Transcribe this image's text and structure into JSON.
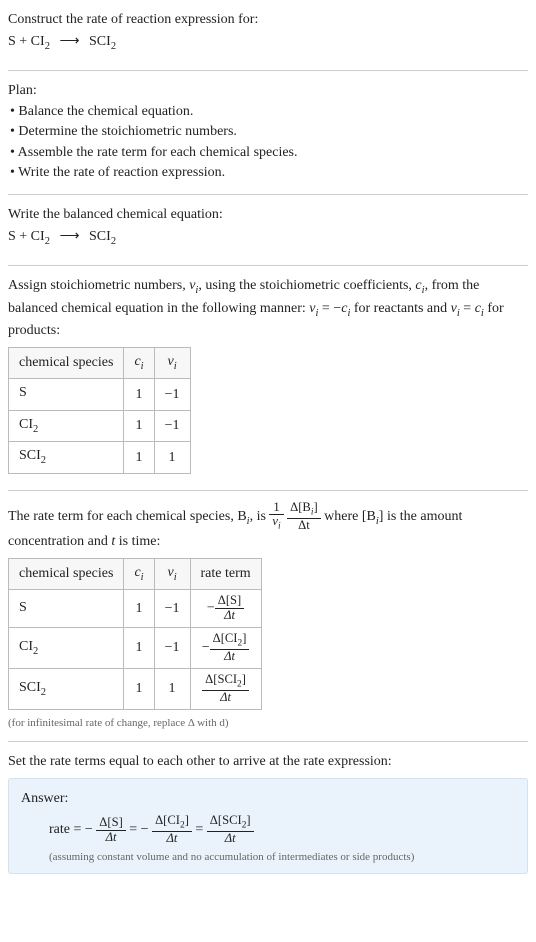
{
  "header": {
    "prompt": "Construct the rate of reaction expression for:",
    "reaction_lhs": "S + CI",
    "reaction_lhs_sub": "2",
    "arrow": "⟶",
    "reaction_rhs": "SCI",
    "reaction_rhs_sub": "2"
  },
  "plan": {
    "title": "Plan:",
    "items": [
      "• Balance the chemical equation.",
      "• Determine the stoichiometric numbers.",
      "• Assemble the rate term for each chemical species.",
      "• Write the rate of reaction expression."
    ]
  },
  "balanced": {
    "intro": "Write the balanced chemical equation:",
    "lhs": "S + CI",
    "lhs_sub": "2",
    "arrow": "⟶",
    "rhs": "SCI",
    "rhs_sub": "2"
  },
  "stoich_text": {
    "p1a": "Assign stoichiometric numbers, ",
    "nu": "ν",
    "isub": "i",
    "p1b": ", using the stoichiometric coefficients, ",
    "c": "c",
    "p1c": ", from the balanced chemical equation in the following manner: ",
    "eq1": " = −",
    "p1d": " for reactants and ",
    "eq2": " = ",
    "p1e": " for products:"
  },
  "table1": {
    "headers": {
      "species": "chemical species",
      "ci": "c",
      "ci_sub": "i",
      "vi": "ν",
      "vi_sub": "i"
    },
    "rows": [
      {
        "species": "S",
        "sub": "",
        "ci": "1",
        "vi": "−1"
      },
      {
        "species": "CI",
        "sub": "2",
        "ci": "1",
        "vi": "−1"
      },
      {
        "species": "SCI",
        "sub": "2",
        "ci": "1",
        "vi": "1"
      }
    ]
  },
  "rateterm_text": {
    "a": "The rate term for each chemical species, B",
    "isub": "i",
    "b": ", is ",
    "one": "1",
    "nu": "ν",
    "delta": "Δ[B",
    "closeb": "]",
    "dt": "Δt",
    "c": " where [B",
    "d": "] is the amount concentration and ",
    "t": "t",
    "e": " is time:"
  },
  "table2": {
    "headers": {
      "species": "chemical species",
      "ci": "c",
      "ci_sub": "i",
      "vi": "ν",
      "vi_sub": "i",
      "rate": "rate term"
    },
    "rows": [
      {
        "species": "S",
        "sub": "",
        "ci": "1",
        "vi": "−1",
        "neg": "−",
        "dnum": "Δ[S]",
        "dden": "Δt"
      },
      {
        "species": "CI",
        "sub": "2",
        "ci": "1",
        "vi": "−1",
        "neg": "−",
        "dnum": "Δ[CI",
        "dnum_sub": "2",
        "dnum_close": "]",
        "dden": "Δt"
      },
      {
        "species": "SCI",
        "sub": "2",
        "ci": "1",
        "vi": "1",
        "neg": "",
        "dnum": "Δ[SCI",
        "dnum_sub": "2",
        "dnum_close": "]",
        "dden": "Δt"
      }
    ],
    "footnote": "(for infinitesimal rate of change, replace Δ with d)"
  },
  "final": {
    "intro": "Set the rate terms equal to each other to arrive at the rate expression:",
    "answer_label": "Answer:",
    "rate": "rate = −",
    "eq": " = −",
    "eq2": " = ",
    "t1_num": "Δ[S]",
    "t1_den": "Δt",
    "t2_num": "Δ[CI",
    "t2_sub": "2",
    "t2_close": "]",
    "t2_den": "Δt",
    "t3_num": "Δ[SCI",
    "t3_sub": "2",
    "t3_close": "]",
    "t3_den": "Δt",
    "assumption": "(assuming constant volume and no accumulation of intermediates or side products)"
  }
}
